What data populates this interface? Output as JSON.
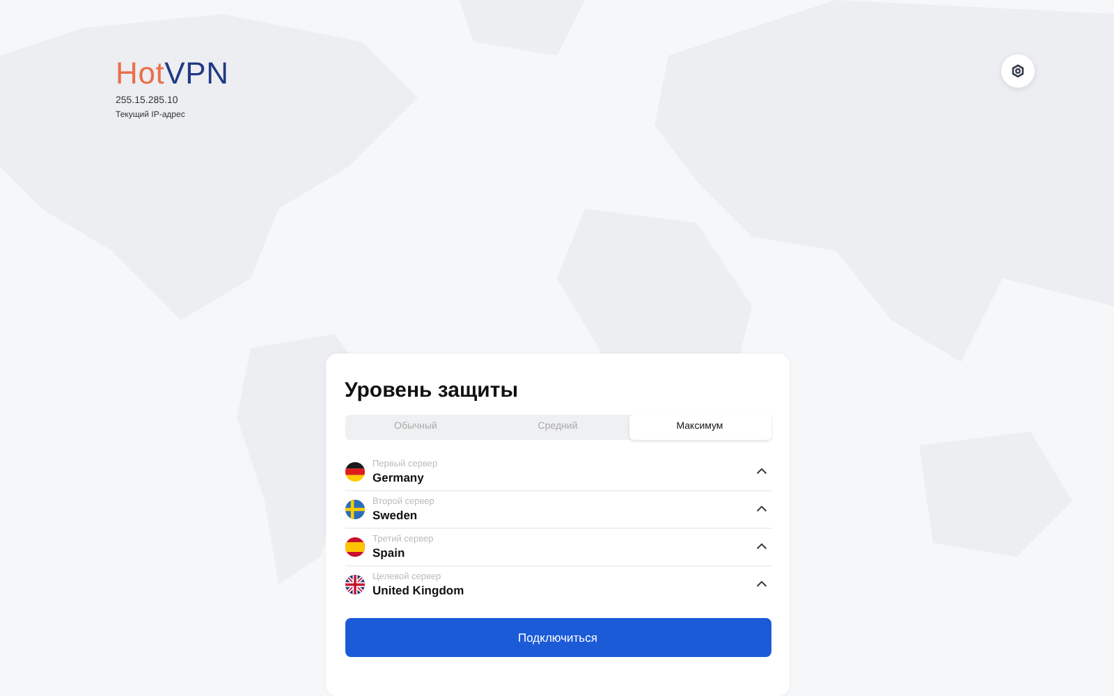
{
  "logo": [
    {
      "text": "Hot",
      "color": "#e8704a"
    },
    {
      "text": "VPN",
      "color": "#213a86"
    }
  ],
  "ip": {
    "address": "255.15.285.10",
    "caption": "Текущий IP-адрес"
  },
  "panel": {
    "title": "Уровень защиты",
    "tabs": [
      {
        "label": "Обычный",
        "selected": false
      },
      {
        "label": "Средний",
        "selected": false
      },
      {
        "label": "Максимум",
        "selected": true
      }
    ],
    "servers": [
      {
        "label": "Первый сервер",
        "country": "Germany",
        "kind": "de",
        "expanded": false
      },
      {
        "label": "Второй сервер",
        "country": "Sweden",
        "kind": "se",
        "expanded": false
      },
      {
        "label": "Третий сервер",
        "country": "Spain",
        "kind": "es",
        "expanded": false
      },
      {
        "label": "Целевой сервер",
        "country": "United Kingdom",
        "kind": "gb",
        "expanded": false
      }
    ],
    "button": "Подключиться"
  }
}
